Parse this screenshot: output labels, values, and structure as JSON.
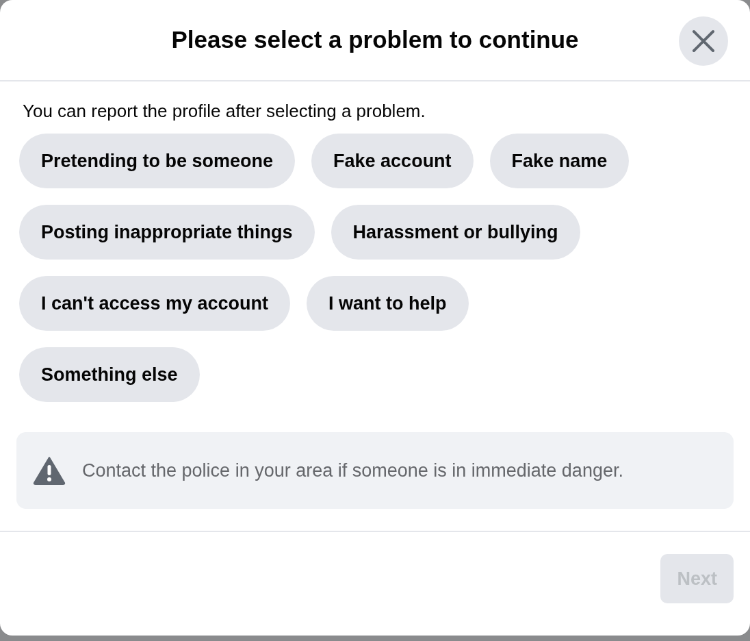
{
  "dialog": {
    "title": "Please select a problem to continue"
  },
  "instructions": "You can report the profile after selecting a problem.",
  "problem_rows": [
    [
      {
        "label": "Pretending to be someone",
        "selected": false
      },
      {
        "label": "Fake account",
        "selected": false
      },
      {
        "label": "Fake name",
        "selected": false
      }
    ],
    [
      {
        "label": "Posting inappropriate things",
        "selected": false
      },
      {
        "label": "Harassment or bullying",
        "selected": false
      }
    ],
    [
      {
        "label": "I can't access my account",
        "selected": false
      },
      {
        "label": "I want to help",
        "selected": false
      }
    ],
    [
      {
        "label": "Something else",
        "selected": false
      }
    ]
  ],
  "notice": "Contact the police in your area if someone is in immediate danger.",
  "next_button": {
    "label": "Next",
    "disabled": true
  }
}
